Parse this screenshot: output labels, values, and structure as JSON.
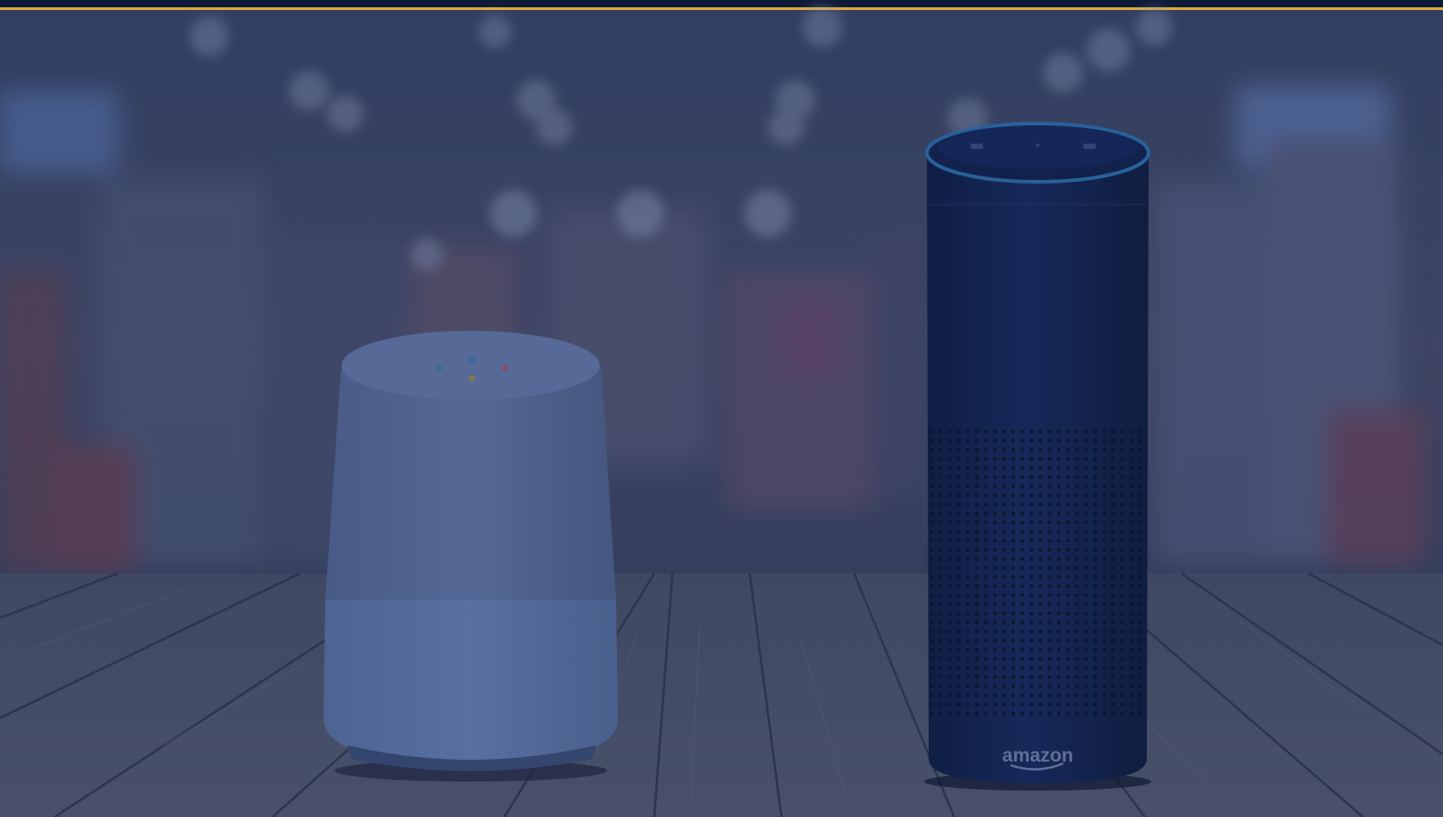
{
  "image": {
    "description_icon": "smart-speakers-photo",
    "overlay_color": "#1e2c55",
    "top_bar_color": "#0f1a3a",
    "top_bar_accent": "#e0a93a"
  },
  "speakers": {
    "right_logo_text": "amazon"
  }
}
